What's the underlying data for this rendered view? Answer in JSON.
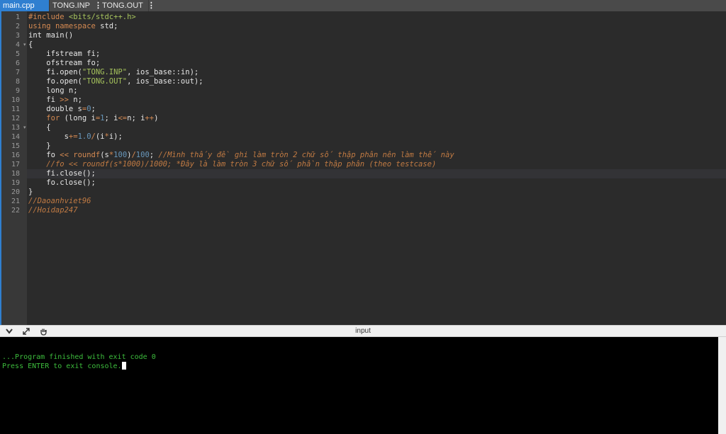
{
  "tabs": [
    {
      "label": "main.cpp",
      "active": true
    },
    {
      "label": "TONG.INP",
      "active": false
    },
    {
      "label": "TONG.OUT",
      "active": false
    }
  ],
  "editor": {
    "line_numbers": [
      "1",
      "2",
      "3",
      "4",
      "5",
      "6",
      "7",
      "8",
      "9",
      "10",
      "11",
      "12",
      "13",
      "14",
      "15",
      "16",
      "17",
      "18",
      "19",
      "20",
      "21",
      "22"
    ],
    "fold_lines": [
      4,
      13
    ]
  },
  "splitter": {
    "title": "input"
  },
  "console": {
    "line1": "...Program finished with exit code 0",
    "line2": "Press ENTER to exit console."
  },
  "colors": {
    "accent": "#2f7fd0",
    "console_text": "#3dbd3d"
  }
}
